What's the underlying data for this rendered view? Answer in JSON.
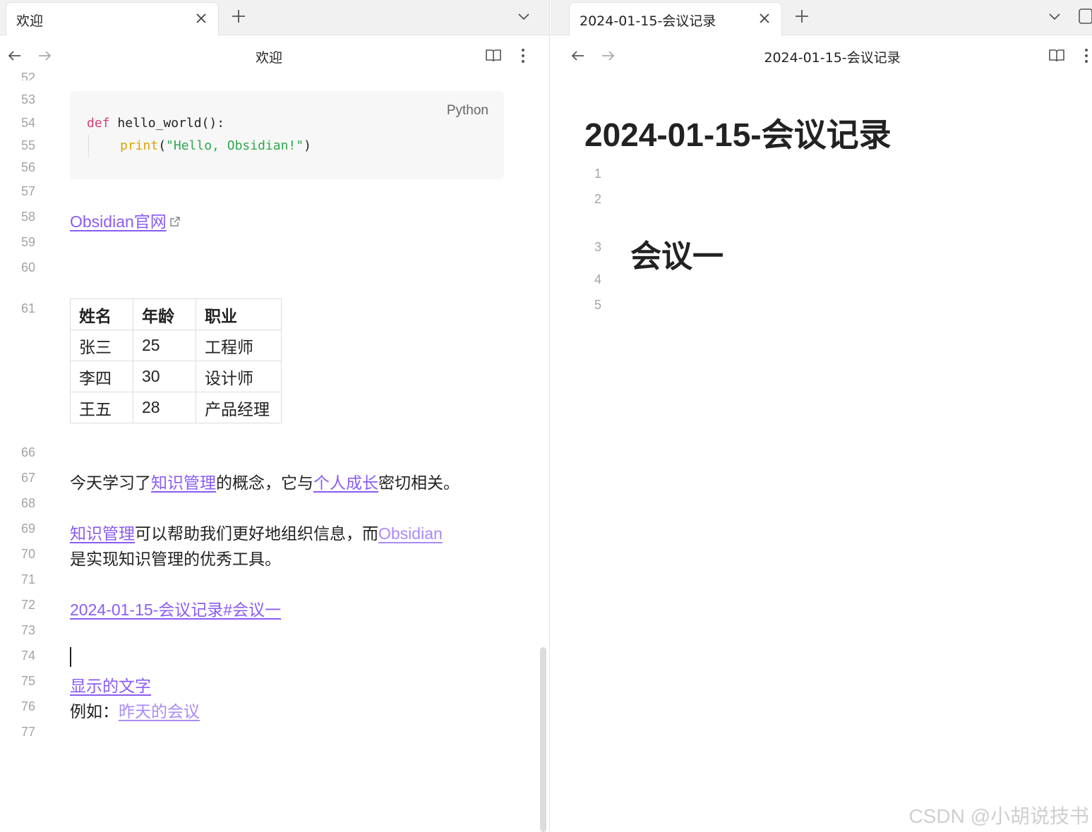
{
  "left": {
    "tab_title": "欢迎",
    "view_title": "欢迎",
    "code": {
      "language": "Python",
      "line1": {
        "kw": "def",
        "rest": " hello_world():"
      },
      "line2": {
        "fn": "print",
        "open": "(",
        "str": "\"Hello, Obsidian!\"",
        "close": ")"
      }
    },
    "gutter": [
      "52",
      "53",
      "54",
      "55",
      "56",
      "57",
      "58",
      "59",
      "60",
      "61",
      "66",
      "67",
      "68",
      "69",
      "70",
      "71",
      "72",
      "73",
      "74",
      "75",
      "76",
      "77"
    ],
    "lines": {
      "l58_link": "Obsidian官网",
      "l67_a": "今天学习了",
      "l67_link1": "知识管理",
      "l67_b": "的概念，它与",
      "l67_link2": "个人成长",
      "l67_c": "密切相关。",
      "l69_link1": "知识管理",
      "l69_a": "可以帮助我们更好地组织信息，而",
      "l69_link2": "Obsidian",
      "l70": "是实现知识管理的优秀工具。",
      "l72_link": "2024-01-15-会议记录#会议一",
      "l75_link": "显示的文字",
      "l76_a": "例如：",
      "l76_link": "昨天的会议"
    },
    "table": {
      "headers": [
        "姓名",
        "年龄",
        "职业"
      ],
      "rows": [
        [
          "张三",
          "25",
          "工程师"
        ],
        [
          "李四",
          "30",
          "设计师"
        ],
        [
          "王五",
          "28",
          "产品经理"
        ]
      ]
    }
  },
  "right": {
    "tab_title": "2024-01-15-会议记录",
    "view_title": "2024-01-15-会议记录",
    "doc_title": "2024-01-15-会议记录",
    "gutter": [
      "1",
      "2",
      "3",
      "4",
      "5"
    ],
    "heading": "会议一"
  },
  "watermark": "CSDN @小胡说技书",
  "colors": {
    "link": "#8a5cf5",
    "keyword": "#d63e77",
    "function": "#d9a300",
    "string": "#2fa84f"
  }
}
